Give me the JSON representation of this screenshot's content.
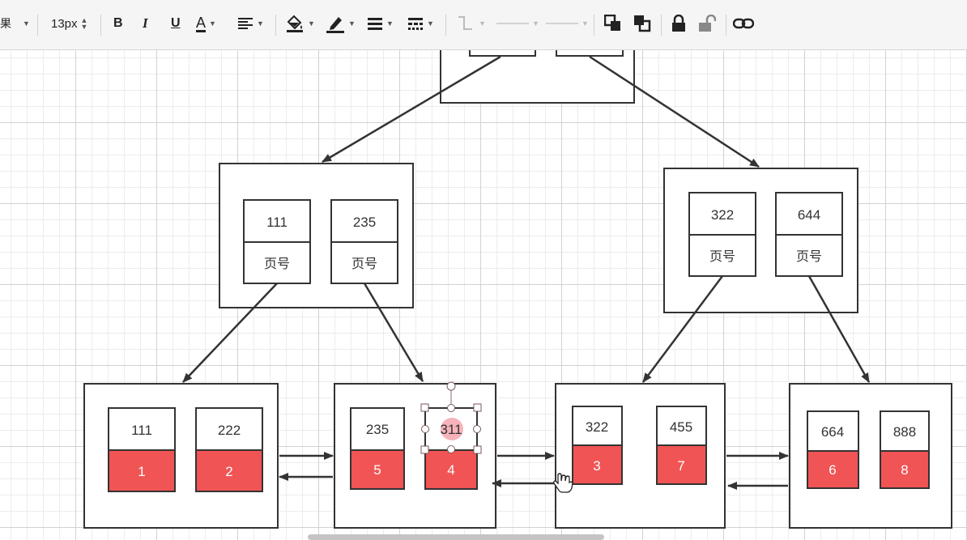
{
  "toolbar": {
    "truncated_label": "果",
    "font_size": "13px",
    "bold": "B",
    "italic": "I",
    "underline": "U",
    "font_color": "A",
    "icons": [
      "align-left-icon",
      "fill-bucket-icon",
      "pen-color-icon",
      "line-weight-icon",
      "dash-style-icon",
      "connector-style-icon",
      "line-start-icon",
      "line-end-icon",
      "bring-to-front-icon",
      "send-to-back-icon",
      "lock-icon",
      "unlock-icon",
      "link-icon"
    ]
  },
  "diagram": {
    "colors": {
      "border": "#333333",
      "red": "#f05454",
      "selection": "#7a5a5a",
      "highlight": "#f4a0aa"
    },
    "level1": [
      {
        "key": "111",
        "ptr": "页号"
      },
      {
        "key": "235",
        "ptr": "页号"
      },
      {
        "key": "322",
        "ptr": "页号"
      },
      {
        "key": "644",
        "ptr": "页号"
      }
    ],
    "leaves": [
      {
        "key": "111",
        "val": "1"
      },
      {
        "key": "222",
        "val": "2"
      },
      {
        "key": "235",
        "val": "5"
      },
      {
        "key": "311",
        "val": "4",
        "selected": true
      },
      {
        "key": "322",
        "val": "3"
      },
      {
        "key": "455",
        "val": "7"
      },
      {
        "key": "664",
        "val": "6"
      },
      {
        "key": "888",
        "val": "8"
      }
    ]
  }
}
